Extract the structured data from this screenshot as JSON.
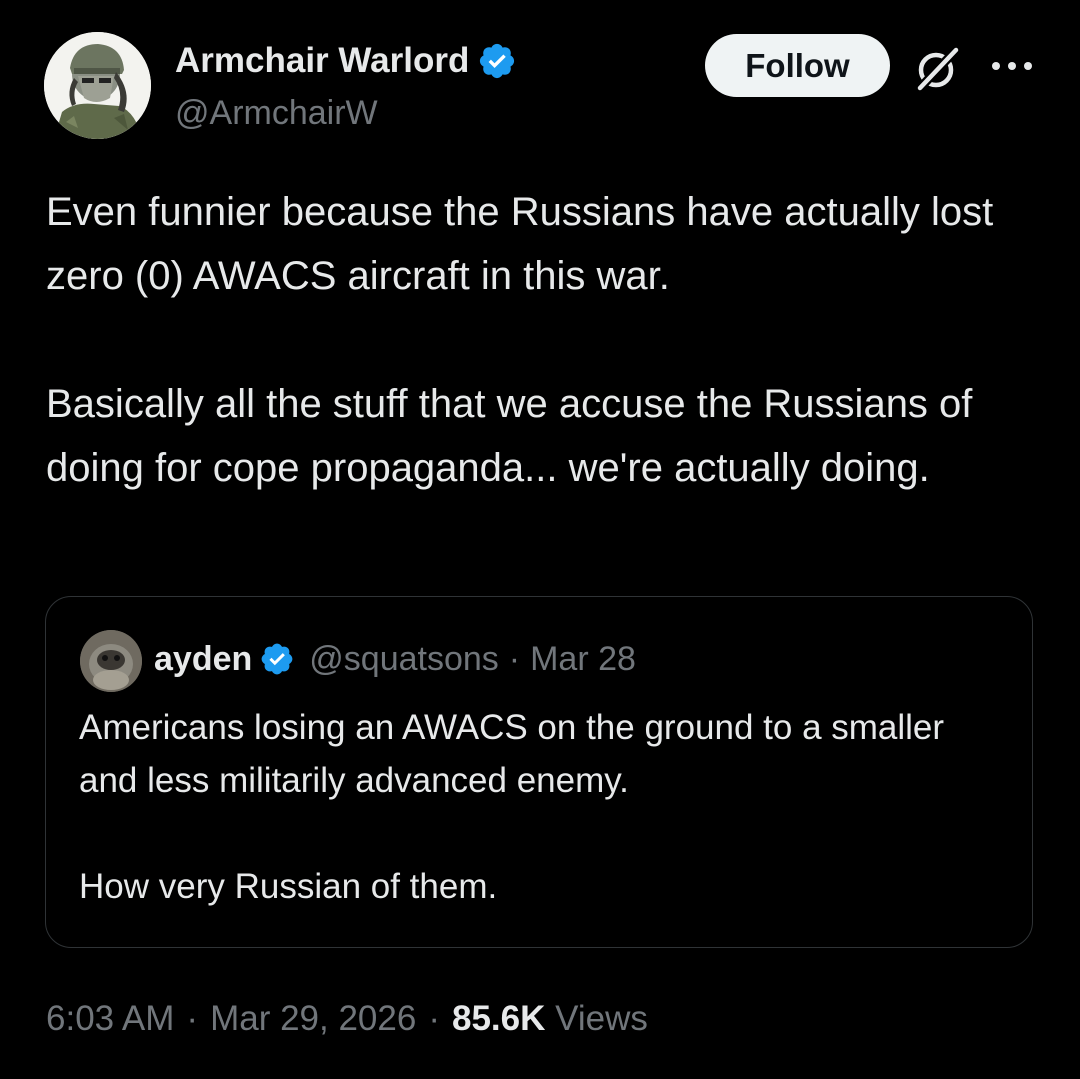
{
  "author": {
    "name": "Armchair Warlord",
    "handle": "@ArmchairW",
    "verified": true
  },
  "actions": {
    "follow_label": "Follow",
    "grok_icon": "grok-slash-icon",
    "more_icon": "more-dots-icon"
  },
  "tweet": {
    "paragraphs": [
      "Even funnier because the Russians have actually lost zero (0) AWACS aircraft in this war.",
      "Basically all the stuff that we accuse the Russians of doing for cope propaganda... we're actually doing."
    ]
  },
  "quote": {
    "name": "ayden",
    "handle": "@squatsons",
    "separator": "·",
    "date": "Mar 28",
    "verified": true,
    "paragraphs": [
      "Americans losing an AWACS on the ground to a smaller and less militarily advanced enemy.",
      "How very Russian of them."
    ]
  },
  "meta": {
    "time": "6:03 AM",
    "separator": "·",
    "date": "Mar 29, 2026",
    "views_count": "85.6K",
    "views_label": "Views"
  },
  "colors": {
    "background": "#000000",
    "text": "#e7e9ea",
    "muted": "#71767b",
    "verified_blue": "#1d9bf0",
    "border": "#2f3336",
    "follow_bg": "#eff3f4"
  }
}
